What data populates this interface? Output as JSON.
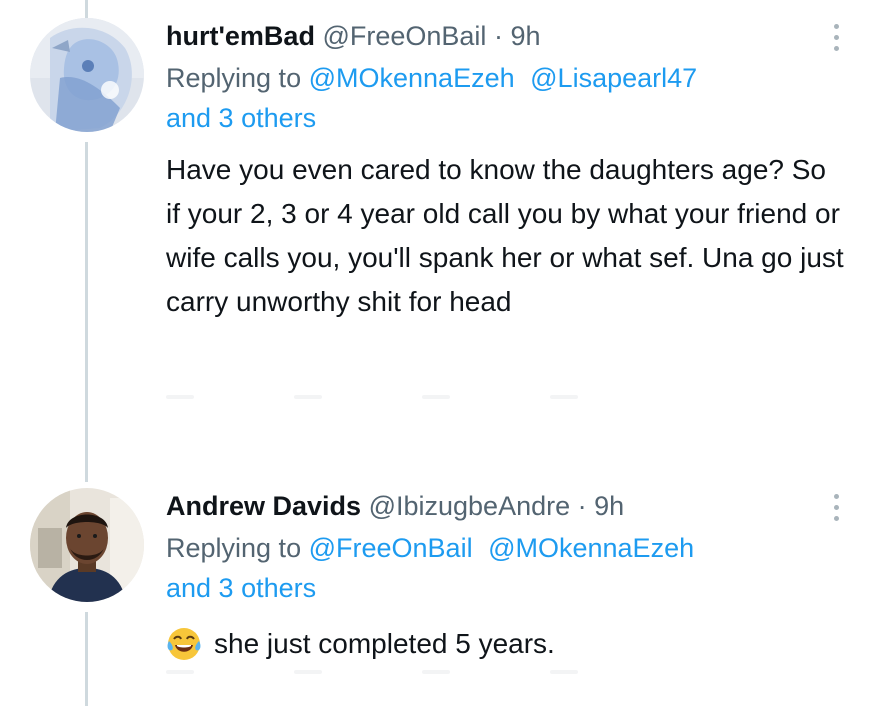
{
  "tweets": [
    {
      "display_name": "hurt'emBad",
      "handle": "@FreeOnBail",
      "separator": "·",
      "time": "9h",
      "replying_prefix": "Replying to",
      "mentions": [
        "@MOkennaEzeh",
        "@Lisapearl47"
      ],
      "others": "and 3 others",
      "body": "Have you even cared to know the daughters age? So if your 2, 3 or 4 year old call you by what your friend or wife calls you, you'll spank her or what sef. Una go just carry unworthy shit for head",
      "avatar_icon": "illustrated-avatar-icon",
      "more_icon": "more-options-icon"
    },
    {
      "display_name": "Andrew Davids",
      "handle": "@IbizugbeAndre",
      "separator": "·",
      "time": "9h",
      "replying_prefix": "Replying to",
      "mentions": [
        "@FreeOnBail",
        "@MOkennaEzeh"
      ],
      "others": "and 3 others",
      "emoji_icon": "face-with-tears-of-joy-icon",
      "body": "she just completed 5 years.",
      "avatar_icon": "photo-avatar-icon",
      "more_icon": "more-options-icon"
    }
  ],
  "colors": {
    "link": "#1d9bf0",
    "secondary_text": "#536471",
    "primary_text": "#0f1419",
    "thread_line": "#cfd9de"
  }
}
